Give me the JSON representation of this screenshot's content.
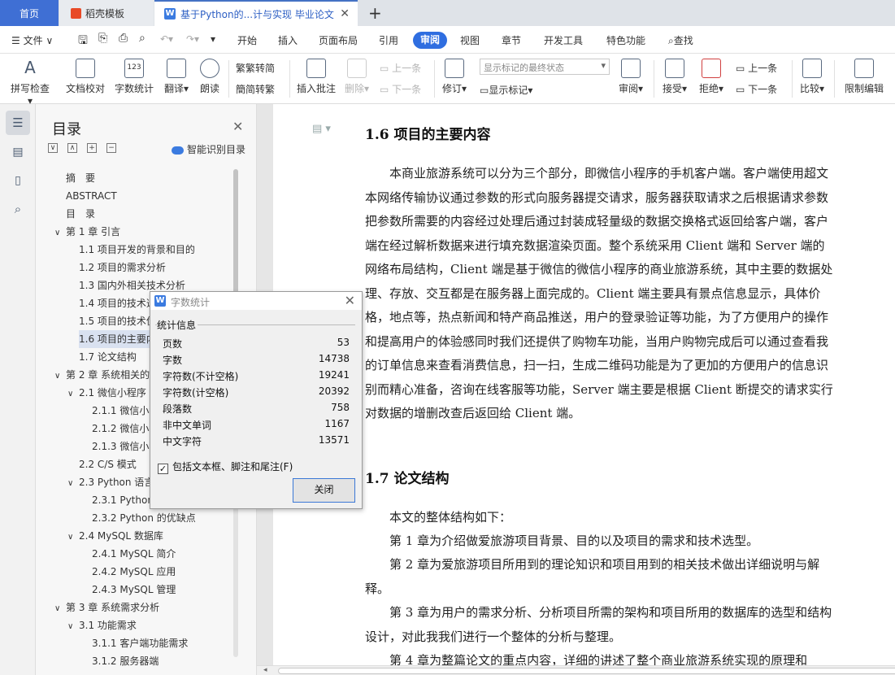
{
  "tabs": {
    "home": "首页",
    "template": "稻壳模板",
    "doc": "基于Python的...计与实现 毕业论文",
    "close": "✕",
    "new": "+"
  },
  "menu": {
    "file": "文件",
    "items": [
      "开始",
      "插入",
      "页面布局",
      "引用",
      "审阅",
      "视图",
      "章节",
      "开发工具",
      "特色功能"
    ],
    "active": "审阅",
    "search": "查找"
  },
  "ribbon": {
    "spell": "拼写检查",
    "proof": "文档校对",
    "wordcount": "字数统计",
    "translate": "翻译",
    "read": "朗读",
    "trad": "繁转简",
    "simp": "简转繁",
    "comment": "插入批注",
    "delete": "删除",
    "prev": "上一条",
    "next": "下一条",
    "revise": "修订",
    "markup_combo": "显示标记的最终状态",
    "show_markup": "显示标记",
    "review": "审阅",
    "accept": "接受",
    "reject": "拒绝",
    "prev2": "上一条",
    "next2": "下一条",
    "compare": "比较",
    "restrict": "限制编辑"
  },
  "nav": {
    "title": "目录",
    "smart": "智能识别目录",
    "items": [
      {
        "text": "摘　要"
      },
      {
        "text": "ABSTRACT"
      },
      {
        "text": "目　录"
      },
      {
        "text": "第 1 章 引言",
        "toggle": "∨"
      },
      {
        "text": "1.1 项目开发的背景和目的"
      },
      {
        "text": "1.2 项目的需求分析"
      },
      {
        "text": "1.3 国内外相关技术分析"
      },
      {
        "text": "1.4 项目的技术选型"
      },
      {
        "text": "1.5 项目的技术优势"
      },
      {
        "text": "1.6 项目的主要内容"
      },
      {
        "text": "1.7 论文结构"
      },
      {
        "text": "第 2 章 系统相关的技术介绍",
        "toggle": "∨"
      },
      {
        "text": "2.1 微信小程序",
        "toggle": "∨"
      },
      {
        "text": "2.1.1 微信小程序的介绍"
      },
      {
        "text": "2.1.2 微信小程序的优势"
      },
      {
        "text": "2.1.3 微信小程序的开发"
      },
      {
        "text": "2.2 C/S 模式"
      },
      {
        "text": "2.3 Python 语言",
        "toggle": "∨"
      },
      {
        "text": "2.3.1 Python 简介"
      },
      {
        "text": "2.3.2 Python 的优缺点"
      },
      {
        "text": "2.4 MySQL 数据库",
        "toggle": "∨"
      },
      {
        "text": "2.4.1 MySQL 简介"
      },
      {
        "text": "2.4.2 MySQL 应用"
      },
      {
        "text": "2.4.3 MySQL 管理"
      },
      {
        "text": "第 3 章 系统需求分析",
        "toggle": "∨"
      },
      {
        "text": "3.1 功能需求",
        "toggle": "∨"
      },
      {
        "text": "3.1.1 客户端功能需求"
      },
      {
        "text": "3.1.2 服务器端"
      }
    ]
  },
  "doc": {
    "h16": "1.6  项目的主要内容",
    "p16": "　　本商业旅游系统可以分为三个部分，即微信小程序的手机客户端。客户端使用超文本网络传输协议通过参数的形式向服务器提交请求，服务器获取请求之后根据请求参数把参数所需要的内容经过处理后通过封装成轻量级的数据交换格式返回给客户端，客户端在经过解析数据来进行填充数据渲染页面。整个系统采用 Client 端和 Server 端的网络布局结构，Client 端是基于微信的微信小程序的商业旅游系统，其中主要的数据处理、存放、交互都是在服务器上面完成的。Client 端主要具有景点信息显示，具体价格，地点等，热点新闻和特产商品推送，用户的登录验证等功能，为了方便用户的操作和提高用户的体验感同时我们还提供了购物车功能，当用户购物完成后可以通过查看我的订单信息来查看消费信息，扫一扫，生成二维码功能是为了更加的方便用户的信息识别而精心准备，咨询在线客服等功能，Server 端主要是根据 Client 断提交的请求实行对数据的增删改查后返回给 Client 端。",
    "h17": "1.7  论文结构",
    "p17a": "　　本文的整体结构如下：",
    "p17b": "　　第 1 章为介绍做爱旅游项目背景、目的以及项目的需求和技术选型。",
    "p17c": "　　第 2 章为爱旅游项目所用到的理论知识和项目用到的相关技术做出详细说明与解释。",
    "p17d": "　　第 3 章为用户的需求分析、分析项目所需的架构和项目所用的数据库的选型和结构设计，对此我我们进行一个整体的分析与整理。",
    "p17e": "　　第 4 章为整篇论文的重点内容，详细的讲述了整个商业旅游系统实现的原理和"
  },
  "dialog": {
    "title": "字数统计",
    "group": "统计信息",
    "rows": [
      {
        "label": "页数",
        "value": "53"
      },
      {
        "label": "字数",
        "value": "14738"
      },
      {
        "label": "字符数(不计空格)",
        "value": "19241"
      },
      {
        "label": "字符数(计空格)",
        "value": "20392"
      },
      {
        "label": "段落数",
        "value": "758"
      },
      {
        "label": "非中文单词",
        "value": "1167"
      },
      {
        "label": "中文字符",
        "value": "13571"
      }
    ],
    "checkbox": "包括文本框、脚注和尾注(F)",
    "close": "关闭"
  }
}
